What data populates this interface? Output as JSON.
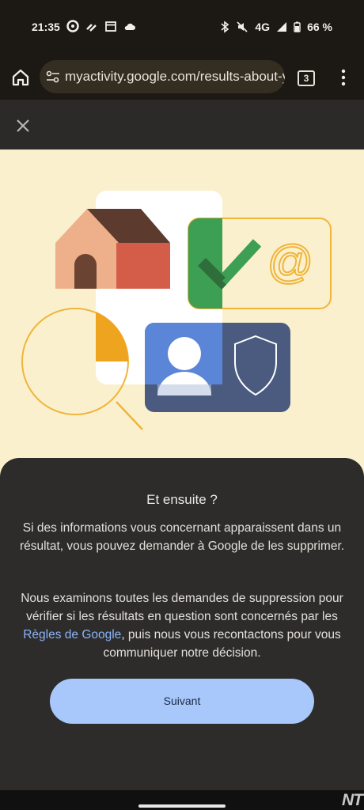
{
  "status_bar": {
    "time": "21:35",
    "network": "4G",
    "battery": "66 %"
  },
  "browser": {
    "url": "myactivity.google.com/results-about-you",
    "tab_count": "3"
  },
  "illustration": {
    "at_symbol": "@"
  },
  "sheet": {
    "title": "Et ensuite ?",
    "paragraph1": "Si des informations vous concernant apparaissent dans un résultat, vous pouvez demander à Google de les supprimer.",
    "paragraph2_before": "Nous examinons toutes les demandes de suppression pour vérifier si les résultats en question sont concernés par les ",
    "paragraph2_link": "Règles de Google",
    "paragraph2_after": ", puis nous vous recontactons pour vous communiquer notre décision.",
    "next_button": "Suivant"
  },
  "watermark": "NT",
  "colors": {
    "link": "#8ab4f8",
    "button_bg": "#a8c7fa",
    "illustration_bg": "#fbf0cd"
  }
}
